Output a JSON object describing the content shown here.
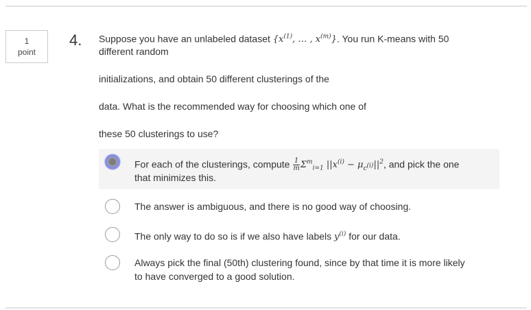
{
  "points": {
    "value": "1",
    "unit": "point"
  },
  "question": {
    "number": "4.",
    "line1_prefix": "Suppose you have an unlabeled dataset ",
    "dataset_math": "{x(1), … , x(m)}",
    "line1_suffix": ". You run K-means with 50",
    "line2": "different random",
    "line3": "initializations, and obtain 50 different clusterings of the",
    "line4": "data. What is the recommended way for choosing which one of",
    "line5": "these 50 clusterings to use?"
  },
  "options": [
    {
      "prefix": "For each of the clusterings, compute ",
      "formula": "1/m Σ_{i=1}^{m} ||x(i) − μ_c(i)||²",
      "suffix": ", and pick the one",
      "line2": "that minimizes this.",
      "selected": true
    },
    {
      "text": "The answer is ambiguous, and there is no good way of choosing.",
      "selected": false
    },
    {
      "prefix": "The only way to do so is if we also have labels ",
      "label_math": "y(i)",
      "suffix": " for our data.",
      "selected": false
    },
    {
      "line1": "Always pick the final (50th) clustering found, since by that time it is more likely",
      "line2": "to have converged to a good solution.",
      "selected": false
    }
  ],
  "colors": {
    "radio_selected_ring": "#8a8fe0",
    "selected_row_bg": "#f4f4f4",
    "rule": "#e2e2e2"
  }
}
